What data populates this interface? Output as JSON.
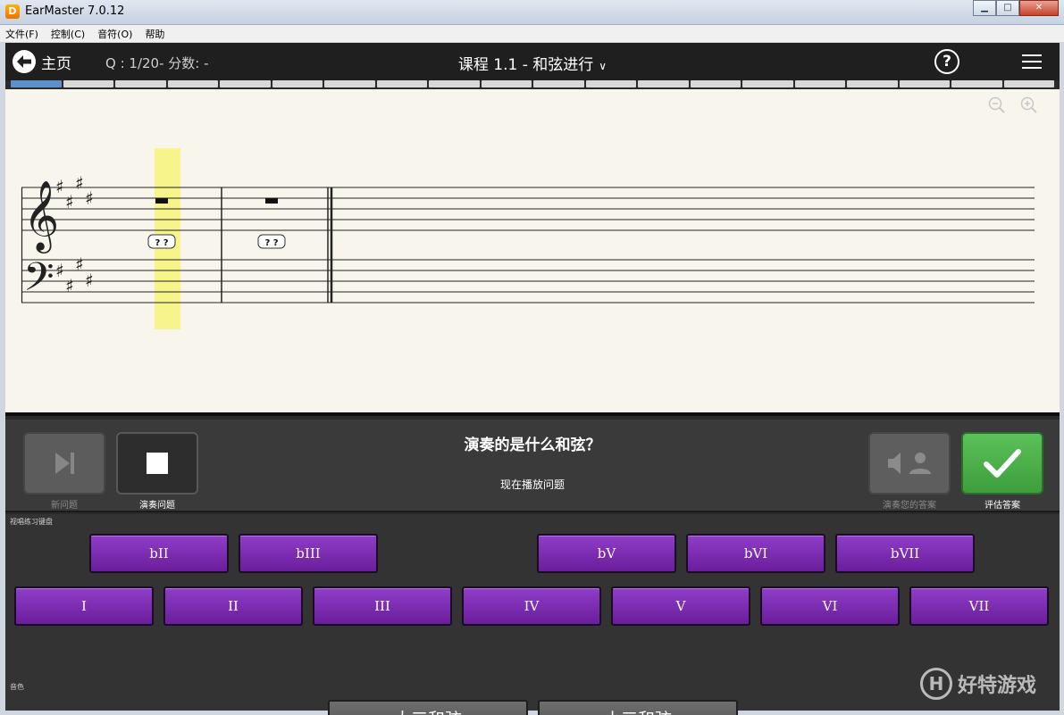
{
  "window": {
    "title": "EarMaster 7.0.12",
    "icon_letter": "D"
  },
  "menu": [
    "文件(F)",
    "控制(C)",
    "音符(O)",
    "帮助"
  ],
  "header": {
    "home_label": "主页",
    "score": "Q : 1/20- 分数: -",
    "lesson_title": "课程 1.1 - 和弦进行",
    "help_symbol": "?"
  },
  "progress": {
    "total": 20,
    "current": 1
  },
  "score_sheet": {
    "chord_labels": [
      "? ?",
      "? ?"
    ]
  },
  "controls": {
    "new_question": "新问题",
    "play_question": "演奏问题",
    "question": "演奏的是什么和弦？",
    "status": "现在播放问题",
    "play_answer": "演奏您的答案",
    "evaluate": "评估答案"
  },
  "keyboard": {
    "section_label": "视唱练习键盘",
    "row1": [
      "bII",
      "bIII",
      "bV",
      "bVI",
      "bVII"
    ],
    "row2": [
      "I",
      "II",
      "III",
      "IV",
      "V",
      "VI",
      "VII"
    ],
    "timbre_label": "音色",
    "timbre": [
      "大三和弦",
      "小三和弦"
    ]
  },
  "watermark": {
    "logo": "H",
    "text": "好特游戏"
  },
  "colors": {
    "accent_purple": "#7a2cb0",
    "accent_green": "#4caf48",
    "progress_blue": "#5d8fcb"
  }
}
